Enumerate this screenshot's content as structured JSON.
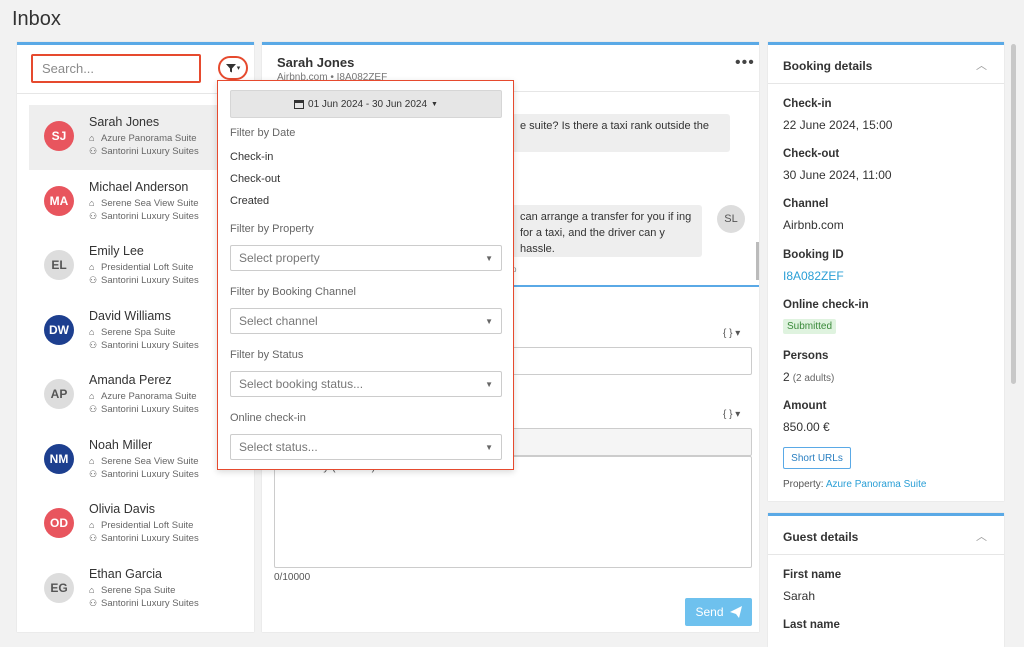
{
  "page": {
    "title": "Inbox"
  },
  "left": {
    "search_placeholder": "Search...",
    "filter_caret": "▾",
    "conversations": [
      {
        "initials": "SJ",
        "name": "Sarah Jones",
        "suite": "Azure Panorama Suite",
        "property": "Santorini Luxury Suites",
        "color": "#e8555e"
      },
      {
        "initials": "MA",
        "name": "Michael Anderson",
        "suite": "Serene Sea View Suite",
        "property": "Santorini Luxury Suites",
        "color": "#e8555e"
      },
      {
        "initials": "EL",
        "name": "Emily Lee",
        "suite": "Presidential Loft Suite",
        "property": "Santorini Luxury Suites",
        "color": "#dddddd"
      },
      {
        "initials": "DW",
        "name": "David Williams",
        "suite": "Serene Spa Suite",
        "property": "Santorini Luxury Suites",
        "color": "#1d3f8f"
      },
      {
        "initials": "AP",
        "name": "Amanda Perez",
        "suite": "Azure Panorama Suite",
        "property": "Santorini Luxury Suites",
        "color": "#dddddd"
      },
      {
        "initials": "NM",
        "name": "Noah Miller",
        "suite": "Serene Sea View Suite",
        "property": "Santorini Luxury Suites",
        "color": "#1d3f8f"
      },
      {
        "initials": "OD",
        "name": "Olivia Davis",
        "suite": "Presidential Loft Suite",
        "property": "Santorini Luxury Suites",
        "color": "#e8555e"
      },
      {
        "initials": "EG",
        "name": "Ethan Garcia",
        "suite": "Serene Spa Suite",
        "property": "Santorini Luxury Suites",
        "color": "#dddddd"
      }
    ]
  },
  "middle": {
    "guest_name": "Sarah Jones",
    "subtitle": "Airbnb.com • I8A082ZEF",
    "more": "•••",
    "message1": "e suite? Is there a taxi rank outside the",
    "message2": "can arrange a transfer for you if ing for a taxi, and the driver can y hassle.",
    "message2_meta": "p",
    "sl_initials": "SL",
    "template_brace": "{ } ▾",
    "body_placeholder": "The body (content) of email",
    "char_count": "0/10000",
    "send_label": "Send"
  },
  "filter_dropdown": {
    "date_range": "01 Jun 2024 - 30 Jun 2024",
    "filter_by_date": "Filter by Date",
    "date_options": [
      "Check-in",
      "Check-out",
      "Created"
    ],
    "filter_by_property": "Filter by Property",
    "property_placeholder": "Select property",
    "filter_by_channel": "Filter by Booking Channel",
    "channel_placeholder": "Select channel",
    "filter_by_status": "Filter by Status",
    "status_placeholder": "Select booking status...",
    "online_checkin": "Online check-in",
    "online_checkin_placeholder": "Select status..."
  },
  "booking": {
    "header": "Booking details",
    "checkin_label": "Check-in",
    "checkin_value": "22 June 2024, 15:00",
    "checkout_label": "Check-out",
    "checkout_value": "30 June 2024, 11:00",
    "channel_label": "Channel",
    "channel_value": "Airbnb.com",
    "booking_id_label": "Booking ID",
    "booking_id_value": "I8A082ZEF",
    "online_checkin_label": "Online check-in",
    "online_checkin_value": "Submitted",
    "persons_label": "Persons",
    "persons_value": "2",
    "persons_sub": "(2 adults)",
    "amount_label": "Amount",
    "amount_value": "850.00 €",
    "short_urls": "Short URLs",
    "property_label": "Property:",
    "property_value": "Azure Panorama Suite"
  },
  "guest": {
    "header": "Guest details",
    "first_name_label": "First name",
    "first_name_value": "Sarah",
    "last_name_label": "Last name"
  }
}
